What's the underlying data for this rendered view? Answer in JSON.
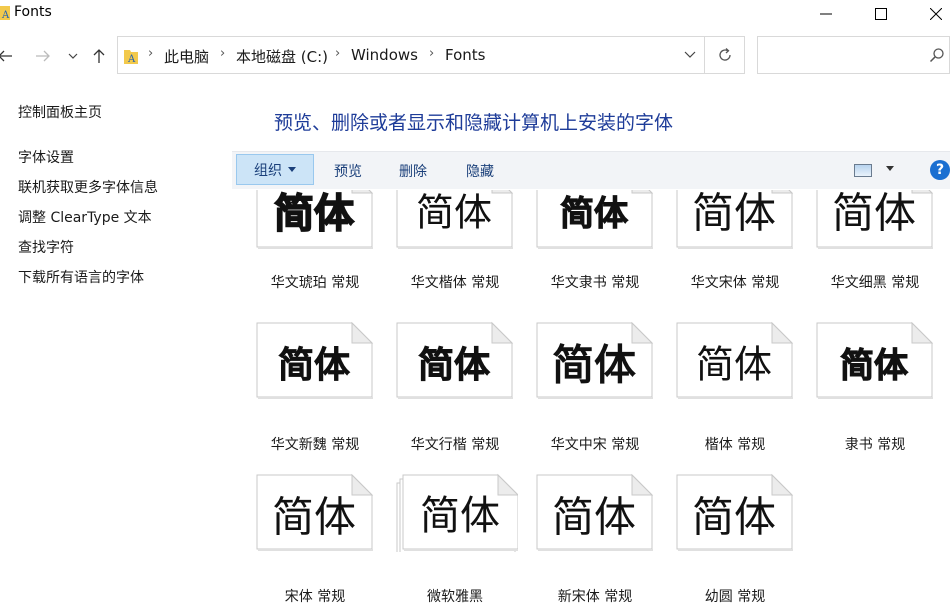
{
  "window": {
    "title": "Fonts"
  },
  "address": {
    "crumbs": [
      "此电脑",
      "本地磁盘 (C:)",
      "Windows",
      "Fonts"
    ]
  },
  "search": {
    "placeholder": ""
  },
  "left_panel": {
    "links": [
      "控制面板主页",
      "字体设置",
      "联机获取更多字体信息",
      "调整 ClearType 文本",
      "查找字符",
      "下载所有语言的字体"
    ]
  },
  "main": {
    "heading": "预览、删除或者显示和隐藏计算机上安装的字体"
  },
  "toolbar": {
    "organize": "组织",
    "preview": "预览",
    "delete": "删除",
    "hide": "隐藏",
    "help": "?"
  },
  "fonts": [
    {
      "label": "华文琥珀 常规",
      "sample": "简体",
      "style": "bold-heavy"
    },
    {
      "label": "华文楷体 常规",
      "sample": "简体",
      "style": "kai"
    },
    {
      "label": "华文隶书 常规",
      "sample": "简体",
      "style": "li-bold"
    },
    {
      "label": "华文宋体 常规",
      "sample": "简体",
      "style": "song-light"
    },
    {
      "label": "华文细黑 常规",
      "sample": "简体",
      "style": "hei-light"
    },
    {
      "label": "华文新魏 常规",
      "sample": "简体",
      "style": "wei"
    },
    {
      "label": "华文行楷 常规",
      "sample": "简体",
      "style": "xingkai"
    },
    {
      "label": "华文中宋 常规",
      "sample": "简体",
      "style": "zhongsong"
    },
    {
      "label": "楷体 常规",
      "sample": "简体",
      "style": "kai"
    },
    {
      "label": "隶书 常规",
      "sample": "简体",
      "style": "li-bold"
    },
    {
      "label": "宋体 常规",
      "sample": "简体",
      "style": "song-light"
    },
    {
      "label": "微软雅黑",
      "sample": "简体",
      "style": "yahei",
      "family": true
    },
    {
      "label": "新宋体 常规",
      "sample": "简体",
      "style": "song-light"
    },
    {
      "label": "幼圆 常规",
      "sample": "简体",
      "style": "song-light"
    }
  ],
  "colors": {
    "heading": "#1e3c99",
    "toolbar_bg": "#f2f4f7",
    "organize_bg": "#cce4f7",
    "help": "#1a6fd1"
  }
}
